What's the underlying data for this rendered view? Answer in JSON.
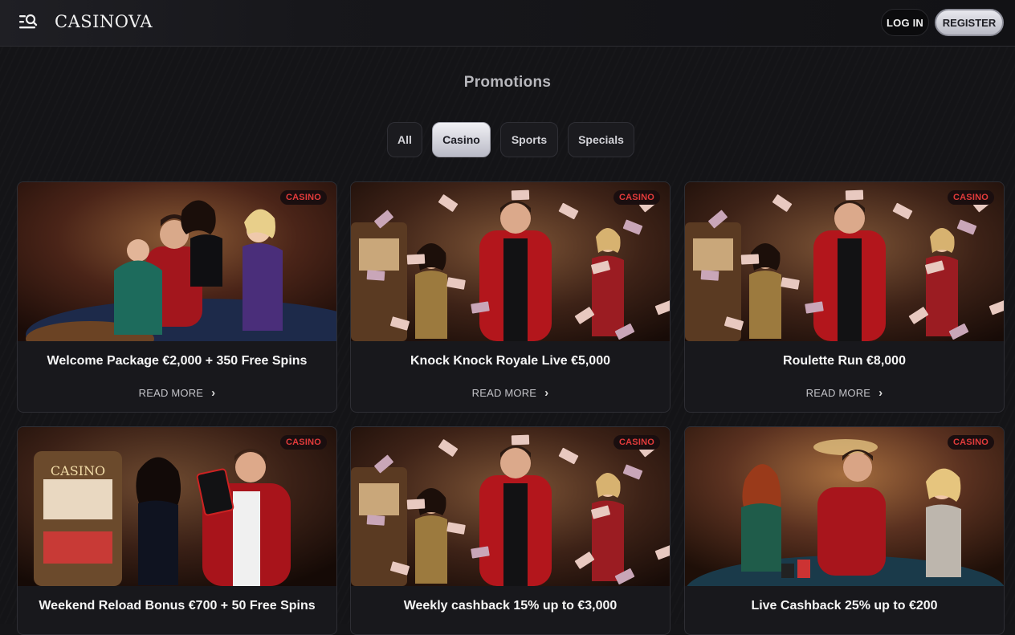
{
  "header": {
    "logo": "CASINOVA",
    "login_label": "LOG IN",
    "register_label": "REGISTER",
    "menu_icon": "menu-search-icon"
  },
  "page": {
    "title": "Promotions"
  },
  "filters": [
    {
      "label": "All",
      "active": false
    },
    {
      "label": "Casino",
      "active": true
    },
    {
      "label": "Sports",
      "active": false
    },
    {
      "label": "Specials",
      "active": false
    }
  ],
  "promotions": [
    {
      "badge": "CASINO",
      "title": "Welcome Package €2,000 + 350 Free Spins",
      "read_more": "READ MORE",
      "scene": "roulette-party"
    },
    {
      "badge": "CASINO",
      "title": "Knock Knock Royale Live €5,000",
      "read_more": "READ MORE",
      "scene": "money-rain"
    },
    {
      "badge": "CASINO",
      "title": "Roulette Run €8,000",
      "read_more": "READ MORE",
      "scene": "money-rain"
    },
    {
      "badge": "CASINO",
      "title": "Weekend Reload Bonus €700 + 50 Free Spins",
      "read_more": "READ MORE",
      "scene": "slots-couple"
    },
    {
      "badge": "CASINO",
      "title": "Weekly cashback 15% up to €3,000",
      "read_more": "READ MORE",
      "scene": "money-rain"
    },
    {
      "badge": "CASINO",
      "title": "Live Cashback 25% up to €200",
      "read_more": "READ MORE",
      "scene": "card-table"
    }
  ],
  "colors": {
    "background": "#141417",
    "badge_text": "#e23b3b",
    "active_filter": "#e0e0e6"
  }
}
